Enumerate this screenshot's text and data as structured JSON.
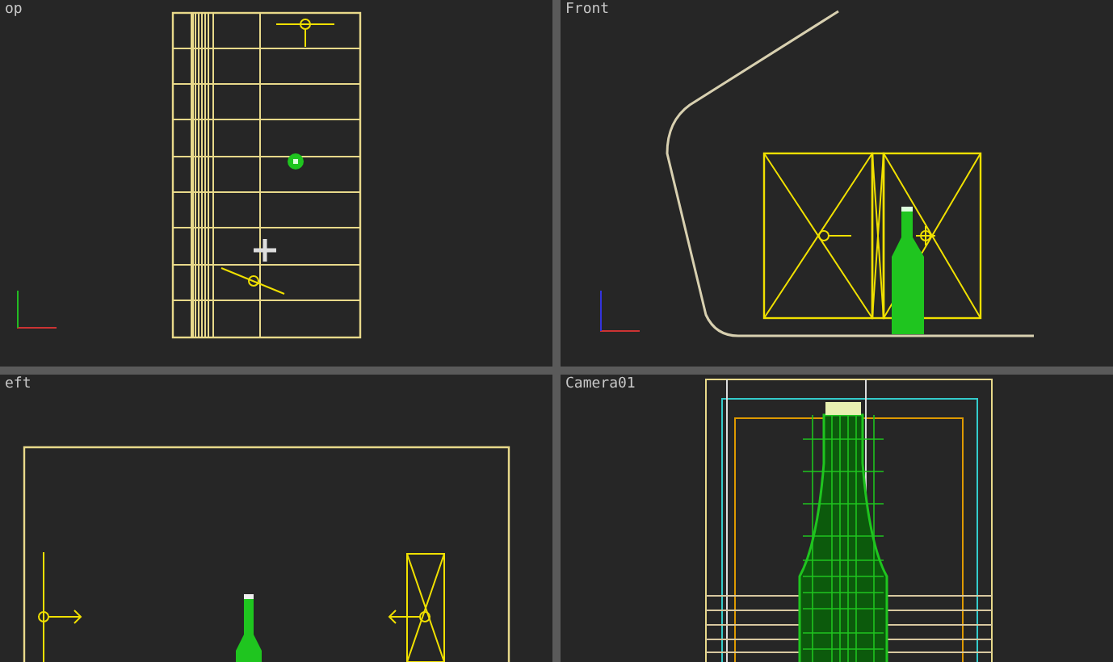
{
  "viewports": [
    {
      "label": "op",
      "kind": "top"
    },
    {
      "label": "Front",
      "kind": "front"
    },
    {
      "label": "eft",
      "kind": "left"
    },
    {
      "label": "Camera01",
      "kind": "camera"
    }
  ]
}
